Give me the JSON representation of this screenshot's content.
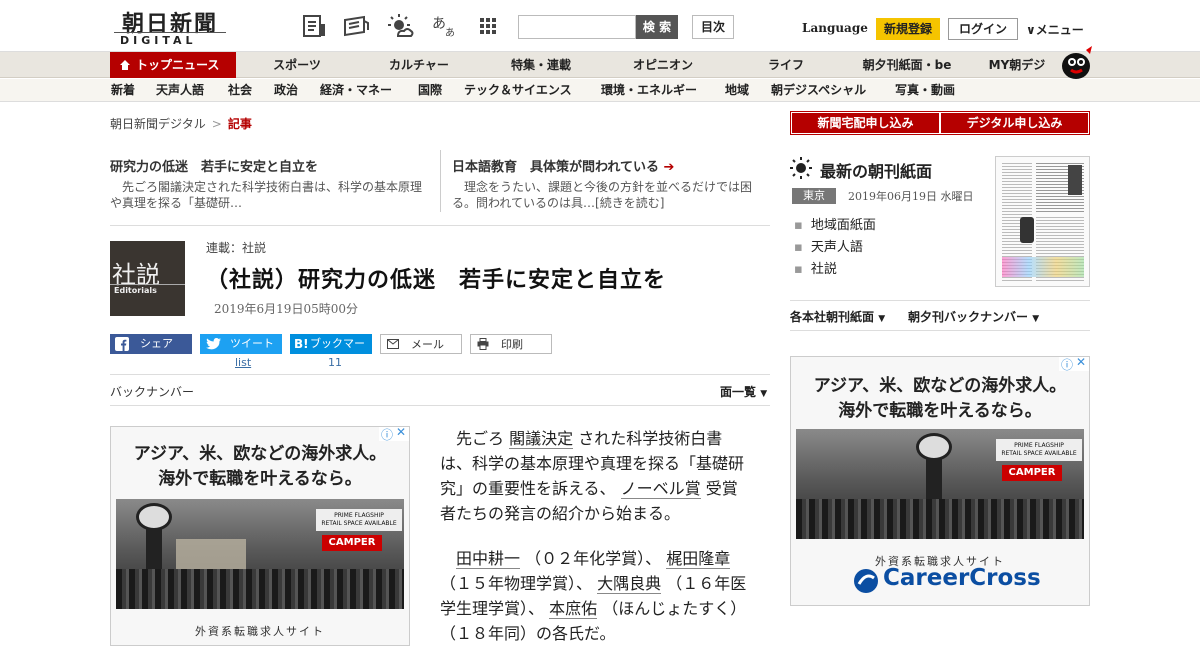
{
  "header": {
    "logo_jp": "朝日新聞",
    "logo_en": "DIGITAL",
    "search_button": "検 索",
    "toc_button": "目次",
    "language": "Language",
    "register": "新規登録",
    "login": "ログイン",
    "menu": "メニュー"
  },
  "nav_primary": {
    "active": "トップニュース",
    "items": [
      "スポーツ",
      "カルチャー",
      "特集・連載",
      "オピニオン",
      "ライフ",
      "朝夕刊紙面・be",
      "MY朝デジ"
    ]
  },
  "nav_secondary": {
    "items": [
      "新着",
      "天声人語",
      "社会",
      "政治",
      "経済・マネー",
      "国際",
      "テック＆サイエンス",
      "環境・エネルギー",
      "地域",
      "朝デジスペシャル",
      "写真・動画"
    ]
  },
  "breadcrumb": {
    "home": "朝日新聞デジタル",
    "sep": ">",
    "current": "記事"
  },
  "related": [
    {
      "title": "研究力の低迷　若手に安定と自立を",
      "body_l1": "　先ごろ閣議決定された科学技術白書は、科学の基本原理",
      "body_l2": "や真理を探る「基礎研…"
    },
    {
      "title": "日本語教育　具体策が問われている",
      "body_l1": "　理念をうたい、課題と今後の方針を並べるだけでは困",
      "body_l2": "る。問われているのは具…[続きを読む]"
    }
  ],
  "article": {
    "thumb_jp": "社説",
    "thumb_en": "Editorials",
    "series": "連載：社説",
    "headline": "（社説）研究力の低迷　若手に安定と自立を",
    "date": "2019年6月19日05時00分"
  },
  "share": {
    "facebook": "シェア",
    "twitter": "ツイート",
    "twitter_count": "list",
    "hatena": "ブックマーク",
    "hatena_count": "11",
    "mail": "メール",
    "print": "印刷"
  },
  "backnumber": {
    "label": "バックナンバー",
    "facelist": "面一覧"
  },
  "ad": {
    "line1": "アジア、米、欧などの海外求人。",
    "line2": "海外で転職を叶えるなら。",
    "site": "外資系転職求人サイト",
    "brand": "CareerCross",
    "store_sign_1": "PRIME FLAGSHIP",
    "store_sign_2": "RETAIL SPACE AVAILABLE",
    "store_sign_3": "CAMPER"
  },
  "body": {
    "p1": {
      "a": "先ごろ",
      "link1": "閣議決定",
      "b": "された科学技術白書は、科学の基本原理や真理を探る「基礎研究」の重要性を訴える、",
      "link2": "ノーベル賞",
      "c": "受賞者たちの発言の紹介から始まる。"
    },
    "p2": {
      "link1": "田中耕一",
      "a": "（０２年化学賞）、",
      "link2": "梶田隆章",
      "b": "（１５年物理学賞）、",
      "link3": "大隅良典",
      "c": "（１６年医学生理学賞）、",
      "link4": "本庶佑",
      "d": "（ほんじょたすく）（１８年同）の各氏だ。"
    }
  },
  "right": {
    "btn_paper": "新聞宅配申し込み",
    "btn_digital": "デジタル申し込み",
    "paper_title": "最新の朝刊紙面",
    "region": "東京",
    "paper_date": "2019年06月19日 水曜日",
    "links": [
      "地域面紙面",
      "天声人語",
      "社説"
    ],
    "link_company": "各本社朝刊紙面",
    "link_back": "朝夕刊バックナンバー"
  },
  "colors": {
    "brand_red": "#b50000",
    "accent_yellow": "#f5c400",
    "facebook": "#3b5998",
    "twitter": "#1da1f2",
    "hatena": "#008fde"
  }
}
